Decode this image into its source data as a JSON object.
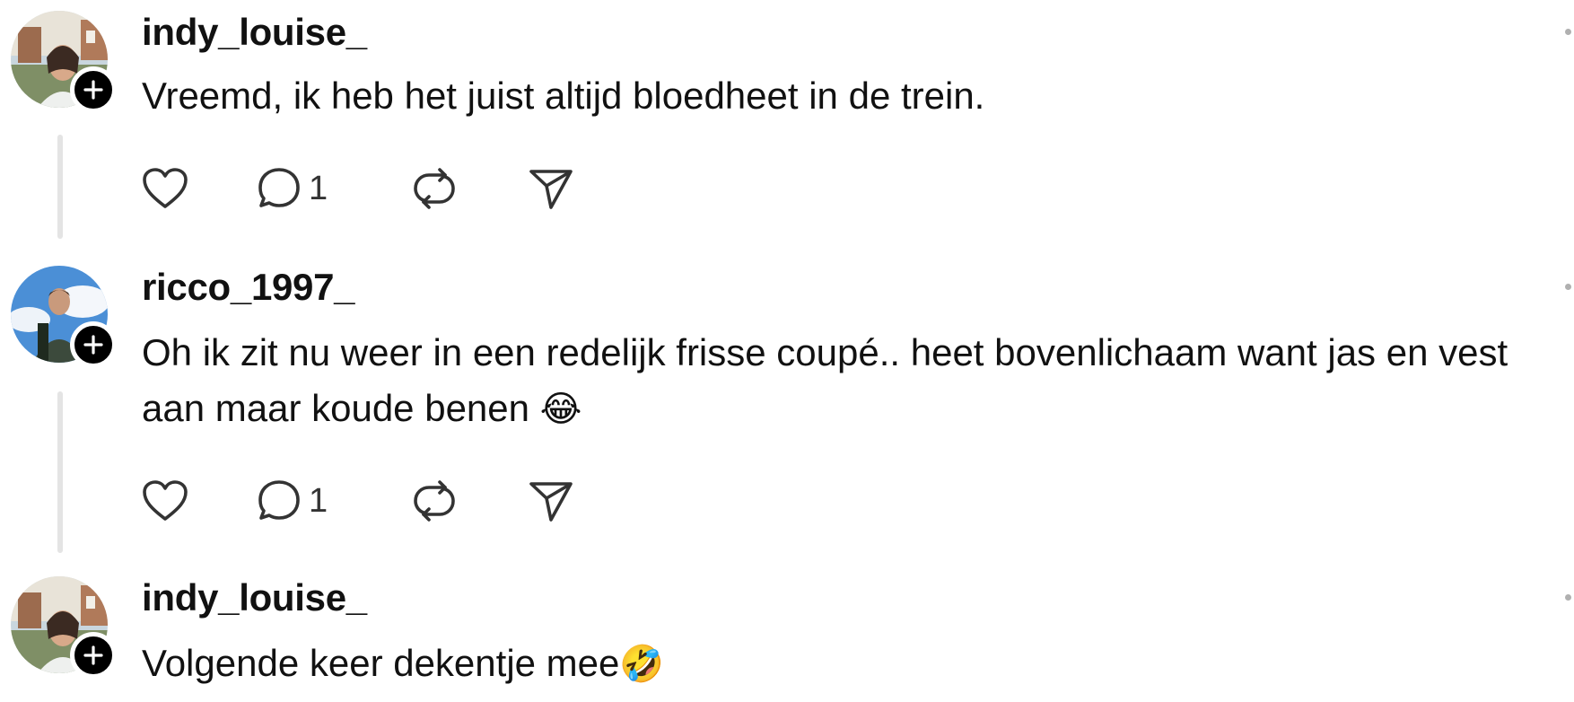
{
  "posts": [
    {
      "username": "indy_louise_",
      "text": "Vreemd, ik heb het juist altijd bloedheet in de trein.",
      "emoji": "",
      "reply_count": "1",
      "avatar": "woman-portrait"
    },
    {
      "username": "ricco_1997_",
      "text": "Oh ik zit nu weer in een redelijk frisse coupé.. heet bovenlichaam want jas en vest aan maar koude benen ",
      "emoji": "😂",
      "reply_count": "1",
      "avatar": "man-portrait-sky"
    },
    {
      "username": "indy_louise_",
      "text": "Volgende keer dekentje mee",
      "emoji": "🤣",
      "reply_count": "",
      "avatar": "woman-portrait"
    }
  ],
  "icons": {
    "like": "heart-icon",
    "comment": "comment-icon",
    "repost": "repost-icon",
    "share": "share-icon",
    "follow": "plus-icon",
    "more": "more-icon"
  },
  "colors": {
    "text": "#111111",
    "thread_line": "#e4e4e4",
    "follow_badge": "#000000",
    "icon_stroke": "#333333"
  }
}
